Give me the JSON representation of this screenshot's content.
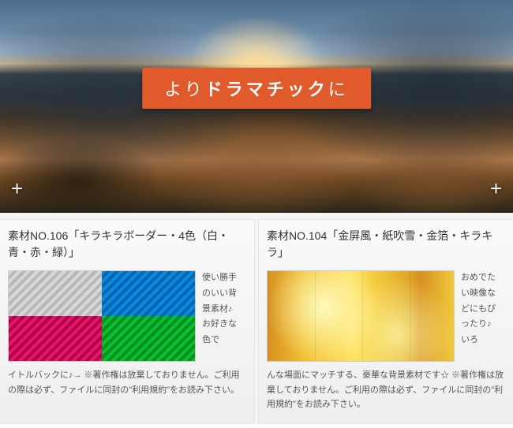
{
  "hero": {
    "banner_pre": "より",
    "banner_bold": "ドラマチック",
    "banner_post": "に"
  },
  "cards": [
    {
      "title": "素材NO.106「キラキラボーダー・4色（白・青・赤・緑）」",
      "side": "使い勝手のいい背景素材♪お好きな色で",
      "desc": "イトルバックに♪→ ※著作権は放棄しておりません。ご利用の際は必ず、ファイルに同封の\"利用規約\"をお読み下さい。"
    },
    {
      "title": "素材NO.104「金屏風・紙吹雪・金箔・キラキラ」",
      "side": "おめでたい映像などにもぴったり♪いろ",
      "desc": "んな場面にマッチする、豪華な背景素材です☆ ※著作権は放棄しておりません。ご利用の際は必ず、ファイルに同封の\"利用規約\"をお読み下さい。"
    }
  ]
}
